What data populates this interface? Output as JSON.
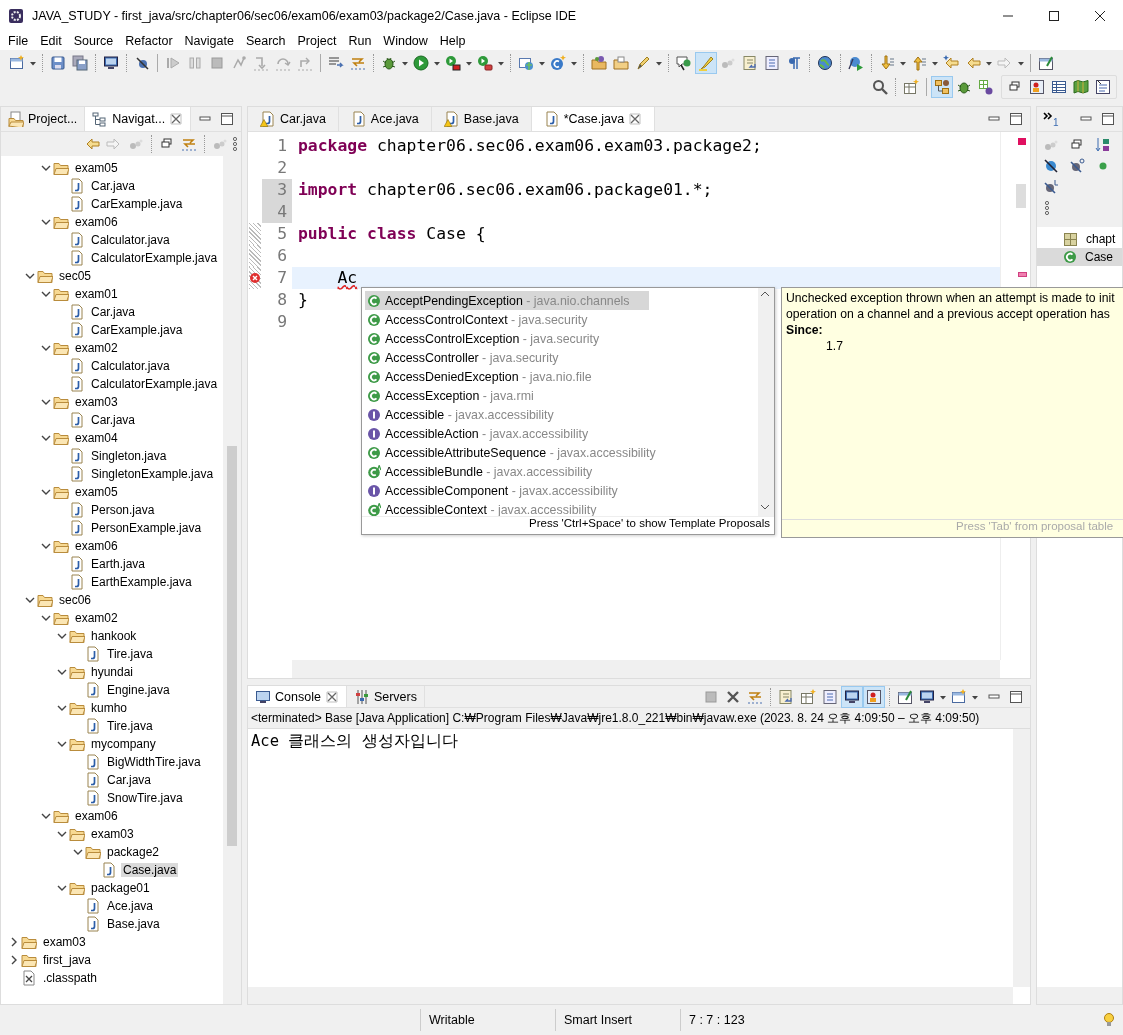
{
  "window": {
    "title": "JAVA_STUDY - first_java/src/chapter06/sec06/exam06/exam03/package2/Case.java - Eclipse IDE"
  },
  "menu": [
    "File",
    "Edit",
    "Source",
    "Refactor",
    "Navigate",
    "Search",
    "Project",
    "Run",
    "Window",
    "Help"
  ],
  "left_panel": {
    "tabs": [
      {
        "label": "Project...",
        "selected": false
      },
      {
        "label": "Navigat...",
        "selected": true
      }
    ],
    "tree": [
      {
        "children": [
          {
            "children": [
              {
                "label": "exam05",
                "kind": "folder",
                "expanded": true,
                "selected": false,
                "children": [
                  {
                    "label": "Car.java",
                    "kind": "file",
                    "selected": false
                  },
                  {
                    "label": "CarExample.java",
                    "kind": "file",
                    "selected": false
                  }
                ]
              },
              {
                "label": "exam06",
                "kind": "folder",
                "expanded": true,
                "selected": false,
                "children": [
                  {
                    "label": "Calculator.java",
                    "kind": "file",
                    "selected": false
                  },
                  {
                    "label": "CalculatorExample.java",
                    "kind": "file",
                    "selected": false
                  }
                ]
              }
            ]
          },
          {
            "label": "sec05",
            "kind": "folder",
            "expanded": true,
            "selected": false,
            "children": [
              {
                "label": "exam01",
                "kind": "folder",
                "expanded": true,
                "selected": false,
                "children": [
                  {
                    "label": "Car.java",
                    "kind": "file",
                    "selected": false
                  },
                  {
                    "label": "CarExample.java",
                    "kind": "file",
                    "selected": false
                  }
                ]
              },
              {
                "label": "exam02",
                "kind": "folder",
                "expanded": true,
                "selected": false,
                "children": [
                  {
                    "label": "Calculator.java",
                    "kind": "file",
                    "selected": false
                  },
                  {
                    "label": "CalculatorExample.java",
                    "kind": "file",
                    "selected": false
                  }
                ]
              },
              {
                "label": "exam03",
                "kind": "folder",
                "expanded": true,
                "selected": false,
                "children": [
                  {
                    "label": "Car.java",
                    "kind": "file",
                    "selected": false
                  }
                ]
              },
              {
                "label": "exam04",
                "kind": "folder",
                "expanded": true,
                "selected": false,
                "children": [
                  {
                    "label": "Singleton.java",
                    "kind": "file",
                    "selected": false
                  },
                  {
                    "label": "SingletonExample.java",
                    "kind": "file",
                    "selected": false
                  }
                ]
              },
              {
                "label": "exam05",
                "kind": "folder",
                "expanded": true,
                "selected": false,
                "children": [
                  {
                    "label": "Person.java",
                    "kind": "file",
                    "selected": false
                  },
                  {
                    "label": "PersonExample.java",
                    "kind": "file",
                    "selected": false
                  }
                ]
              },
              {
                "label": "exam06",
                "kind": "folder",
                "expanded": true,
                "selected": false,
                "children": [
                  {
                    "label": "Earth.java",
                    "kind": "file",
                    "selected": false
                  },
                  {
                    "label": "EarthExample.java",
                    "kind": "file",
                    "selected": false
                  }
                ]
              }
            ]
          },
          {
            "label": "sec06",
            "kind": "folder",
            "expanded": true,
            "selected": false,
            "children": [
              {
                "label": "exam02",
                "kind": "folder",
                "expanded": true,
                "selected": false,
                "children": [
                  {
                    "label": "hankook",
                    "kind": "folder",
                    "expanded": true,
                    "selected": false,
                    "children": [
                      {
                        "label": "Tire.java",
                        "kind": "file",
                        "selected": false
                      }
                    ]
                  },
                  {
                    "label": "hyundai",
                    "kind": "folder",
                    "expanded": true,
                    "selected": false,
                    "children": [
                      {
                        "label": "Engine.java",
                        "kind": "file",
                        "selected": false
                      }
                    ]
                  },
                  {
                    "label": "kumho",
                    "kind": "folder",
                    "expanded": true,
                    "selected": false,
                    "children": [
                      {
                        "label": "Tire.java",
                        "kind": "file",
                        "selected": false
                      }
                    ]
                  },
                  {
                    "label": "mycompany",
                    "kind": "folder",
                    "expanded": true,
                    "selected": false,
                    "children": [
                      {
                        "label": "BigWidthTire.java",
                        "kind": "file",
                        "selected": false
                      },
                      {
                        "label": "Car.java",
                        "kind": "file",
                        "selected": false
                      },
                      {
                        "label": "SnowTire.java",
                        "kind": "file",
                        "selected": false
                      }
                    ]
                  }
                ]
              },
              {
                "label": "exam06",
                "kind": "folder",
                "expanded": true,
                "selected": false,
                "children": [
                  {
                    "label": "exam03",
                    "kind": "folder",
                    "expanded": true,
                    "selected": false,
                    "children": [
                      {
                        "label": "package2",
                        "kind": "folder",
                        "expanded": true,
                        "selected": false,
                        "children": [
                          {
                            "label": "Case.java",
                            "kind": "file",
                            "selected": true
                          }
                        ]
                      }
                    ]
                  },
                  {
                    "label": "package01",
                    "kind": "folder",
                    "expanded": true,
                    "selected": false,
                    "children": [
                      {
                        "label": "Ace.java",
                        "kind": "file",
                        "selected": false
                      },
                      {
                        "label": "Base.java",
                        "kind": "file",
                        "selected": false
                      }
                    ]
                  }
                ]
              }
            ]
          }
        ]
      },
      {
        "label": "exam03",
        "kind": "folder",
        "expanded": false,
        "selected": false
      },
      {
        "label": "first_java",
        "kind": "folder",
        "expanded": false,
        "selected": false
      },
      {
        "label": ".classpath",
        "kind": "xml",
        "selected": false
      }
    ]
  },
  "editor": {
    "tabs": [
      {
        "label": "Car.java",
        "selected": false,
        "warning": true
      },
      {
        "label": "Ace.java",
        "selected": false,
        "warning": false
      },
      {
        "label": "Base.java",
        "selected": false,
        "warning": true
      },
      {
        "label": "*Case.java",
        "selected": true,
        "warning": false
      }
    ],
    "lines": [
      {
        "number": "1",
        "changed": false,
        "added": false,
        "current": false,
        "error": false,
        "tokens": [
          {
            "text": "package",
            "kind": "keyword"
          },
          {
            "text": " chapter06.sec06.exam06.exam03.package2;",
            "kind": "plain"
          }
        ]
      },
      {
        "number": "2",
        "changed": false,
        "added": false,
        "current": false,
        "error": false
      },
      {
        "number": "3",
        "changed": true,
        "added": false,
        "current": false,
        "error": false,
        "tokens": [
          {
            "text": "import",
            "kind": "keyword"
          },
          {
            "text": " chapter06.sec06.exam06.package01.*;",
            "kind": "plain"
          }
        ]
      },
      {
        "number": "4",
        "changed": true,
        "added": false,
        "current": false,
        "error": false
      },
      {
        "number": "5",
        "changed": false,
        "added": true,
        "current": false,
        "error": false,
        "tokens": [
          {
            "text": "public class",
            "kind": "keyword"
          },
          {
            "text": " Case {",
            "kind": "plain"
          }
        ]
      },
      {
        "number": "6",
        "changed": false,
        "added": true,
        "current": false,
        "error": false
      },
      {
        "number": "7",
        "changed": false,
        "added": true,
        "current": true,
        "error": true,
        "indented": true,
        "tokens": [
          {
            "text": "Ac",
            "kind": "error"
          }
        ]
      },
      {
        "number": "8",
        "changed": false,
        "added": false,
        "current": false,
        "error": false,
        "tokens": [
          {
            "text": "}",
            "kind": "plain"
          }
        ]
      },
      {
        "number": "9",
        "changed": false,
        "added": false,
        "current": false,
        "error": false
      }
    ]
  },
  "completion": {
    "proposals": [
      {
        "name": "AcceptPendingException",
        "detail": "- java.nio.channels",
        "kind": "class",
        "selected": true
      },
      {
        "name": "AccessControlContext",
        "detail": "- java.security",
        "kind": "class",
        "selected": false
      },
      {
        "name": "AccessControlException",
        "detail": "- java.security",
        "kind": "class",
        "selected": false
      },
      {
        "name": "AccessController",
        "detail": "- java.security",
        "kind": "class",
        "selected": false
      },
      {
        "name": "AccessDeniedException",
        "detail": "- java.nio.file",
        "kind": "class",
        "selected": false
      },
      {
        "name": "AccessException",
        "detail": "- java.rmi",
        "kind": "class",
        "selected": false
      },
      {
        "name": "Accessible",
        "detail": "- javax.accessibility",
        "kind": "interface",
        "selected": false
      },
      {
        "name": "AccessibleAction",
        "detail": "- javax.accessibility",
        "kind": "interface",
        "selected": false
      },
      {
        "name": "AccessibleAttributeSequence",
        "detail": "- javax.accessibility",
        "kind": "class",
        "selected": false
      },
      {
        "name": "AccessibleBundle",
        "detail": "- javax.accessibility",
        "kind": "abstract",
        "selected": false
      },
      {
        "name": "AccessibleComponent",
        "detail": "- javax.accessibility",
        "kind": "interface",
        "selected": false
      },
      {
        "name": "AccessibleContext",
        "detail": "- javax.accessibility",
        "kind": "abstract",
        "selected": false
      }
    ],
    "hint": "Press 'Ctrl+Space' to show Template Proposals"
  },
  "documentation": {
    "lines": [
      "Unchecked exception thrown when an attempt is made to init",
      "operation on a channel and a previous accept operation has"
    ],
    "since_label": "Since:",
    "since_value": "1.7",
    "footer": "Press 'Tab' from proposal table"
  },
  "outline": {
    "overflow_count": "1",
    "items": [
      {
        "label": "chapt",
        "kind": "package",
        "selected": false
      },
      {
        "label": "Case",
        "kind": "class",
        "selected": true
      }
    ]
  },
  "console": {
    "tabs": [
      {
        "label": "Console",
        "selected": true
      },
      {
        "label": "Servers",
        "selected": false
      }
    ],
    "process": "<terminated> Base [Java Application] C:₩Program Files₩Java₩jre1.8.0_221₩bin₩javaw.exe  (2023. 8. 24 오후 4:09:50 – 오후 4:09:50)",
    "output": "Ace 클래스의 생성자입니다"
  },
  "status_bar": {
    "fields": [
      "Writable",
      "Smart Insert",
      "7 : 7 : 123"
    ]
  }
}
